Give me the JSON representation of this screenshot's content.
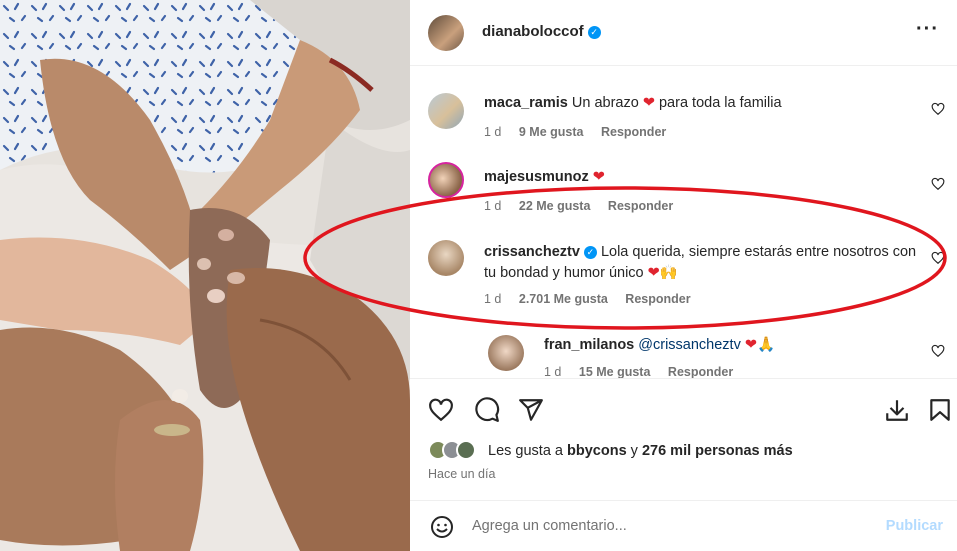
{
  "header": {
    "username": "dianaboloccof",
    "more_icon": "more-icon"
  },
  "comments": [
    {
      "user": "maca_ramis",
      "text": "Un abrazo",
      "emoji": "❤",
      "text2": " para toda la familia",
      "age": "1 d",
      "likes": "9 Me gusta",
      "reply": "Responder"
    },
    {
      "user": "majesusmunoz",
      "text": "",
      "emoji": "❤",
      "text2": "",
      "age": "1 d",
      "likes": "22 Me gusta",
      "reply": "Responder"
    },
    {
      "user": "crissanchezt v",
      "user_display": "crissanchezt v",
      "text": "Lola querida, siempre estarás entre nosotros con tu bondad y humor único",
      "emoji": "❤",
      "emoji2": "🙌",
      "age": "1 d",
      "likes": "2.701 Me gusta",
      "reply": "Responder"
    },
    {
      "user": "fran_milanos",
      "mention": "@crissanchezt v",
      "emoji": "❤",
      "emoji2": "🙏",
      "age": "1 d",
      "likes": "15 Me gusta",
      "reply": "Responder"
    }
  ],
  "likes": {
    "prefix": "Les gusta a",
    "user": "bbycons",
    "mid": "y",
    "count": "276 mil personas más"
  },
  "time": "Hace un día",
  "add_comment": {
    "placeholder": "Agrega un comentario...",
    "publish": "Publicar"
  },
  "colors": {
    "accent": "#0095f6",
    "heart": "#e0242f",
    "highlight": "#e0161e"
  }
}
